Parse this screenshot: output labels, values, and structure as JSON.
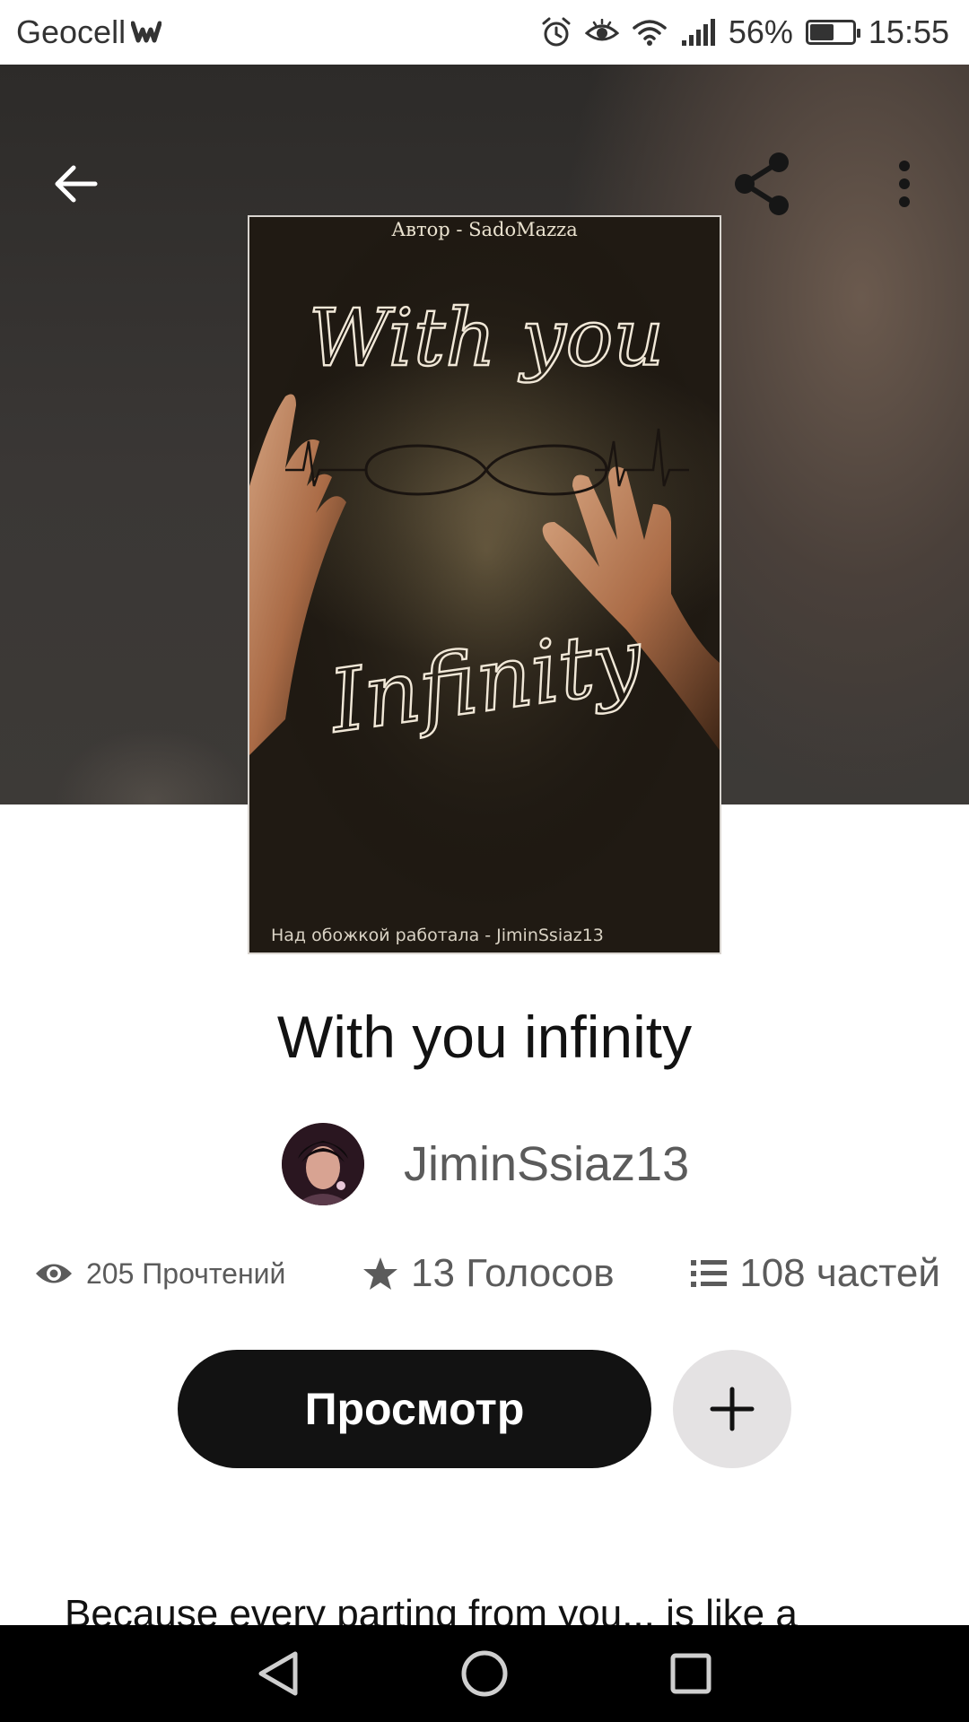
{
  "status_bar": {
    "carrier": "Geocell",
    "battery_percent": "56%",
    "battery_level": 0.56,
    "time": "15:55",
    "icons": [
      "wattpad-icon",
      "alarm-icon",
      "eye-comfort-icon",
      "wifi-icon",
      "signal-icon",
      "battery-icon"
    ]
  },
  "header": {
    "back_icon": "arrow-left-icon",
    "share_icon": "share-icon",
    "menu_icon": "more-vertical-icon"
  },
  "cover": {
    "top_text": "Автор - SadoMazza",
    "bottom_text": "Над обожкой работала - JiminSsiaz13",
    "art_title_line1": "With you",
    "art_title_line2": "Infinity"
  },
  "story": {
    "title": "With you infinity",
    "author": "JiminSsiaz13"
  },
  "stats": {
    "reads": "205 Прочтений",
    "votes": "13 Голосов",
    "parts": "108 частей"
  },
  "actions": {
    "read_label": "Просмотр",
    "add_icon": "plus-icon"
  },
  "description": {
    "text": "Because every parting from you... is like a"
  },
  "nav": {
    "icons": [
      "back-triangle-icon",
      "home-circle-icon",
      "recents-square-icon"
    ]
  }
}
